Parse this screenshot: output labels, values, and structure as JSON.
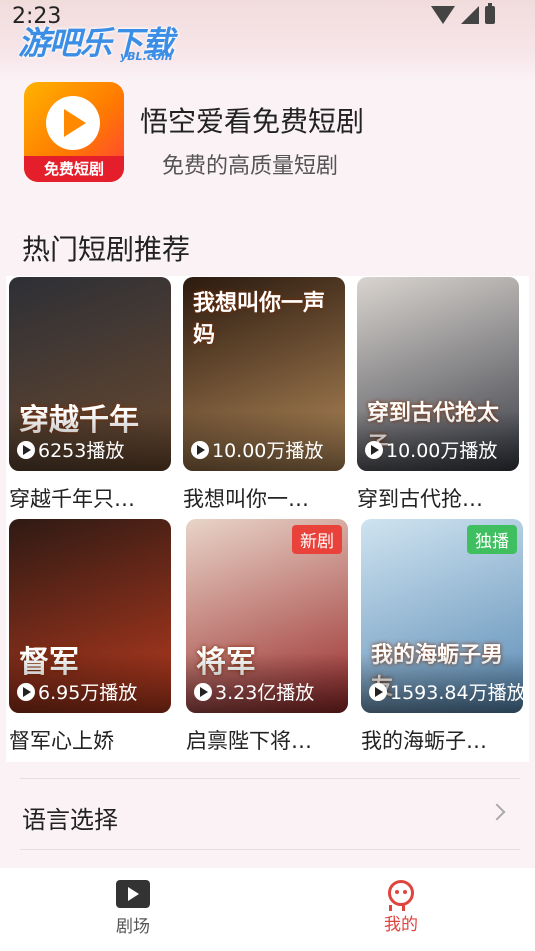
{
  "status": {
    "time": "2:23"
  },
  "watermark": {
    "main": "游吧乐下载",
    "sub": "yBL.com"
  },
  "app": {
    "name": "悟空爱看免费短剧",
    "subtitle": "免费的高质量短剧",
    "icon_badge": "免费短剧",
    "icon": "play-logo-icon"
  },
  "section": {
    "title": "热门短剧推荐"
  },
  "dramas": [
    {
      "title": "穿越千年只…",
      "plays": "6253播放",
      "poster_text": "穿越千年",
      "tag": "",
      "colors": [
        "#2d2f36",
        "#6b4a2f"
      ]
    },
    {
      "title": "我想叫你一…",
      "plays": "10.00万播放",
      "poster_text": "我想叫你一声妈",
      "tag": "",
      "colors": [
        "#2b1a0f",
        "#b48a5a"
      ]
    },
    {
      "title": "穿到古代抢…",
      "plays": "10.00万播放",
      "poster_text": "穿到古代抢太子",
      "tag": "",
      "colors": [
        "#d9d4cf",
        "#3a3d46"
      ]
    },
    {
      "title": "督军心上娇",
      "plays": "6.95万播放",
      "poster_text": "督军",
      "tag": "",
      "colors": [
        "#2e1a14",
        "#b83a1e"
      ]
    },
    {
      "title": "启禀陛下将…",
      "plays": "3.23亿播放",
      "poster_text": "将军",
      "tag": "新剧",
      "colors": [
        "#e8d4c8",
        "#9a2b2b"
      ]
    },
    {
      "title": "我的海蛎子…",
      "plays": "1593.84万播放",
      "poster_text": "我的海蛎子男友",
      "tag": "独播",
      "colors": [
        "#cfe3f0",
        "#5a8bb5"
      ]
    }
  ],
  "tag_colors": {
    "新剧": "#e8423a",
    "独播": "#3fbf5f"
  },
  "menu": {
    "language_label": "语言选择"
  },
  "tabbar": {
    "theater_label": "剧场",
    "me_label": "我的",
    "active_color": "#e0443e",
    "inactive_color": "#555555"
  }
}
